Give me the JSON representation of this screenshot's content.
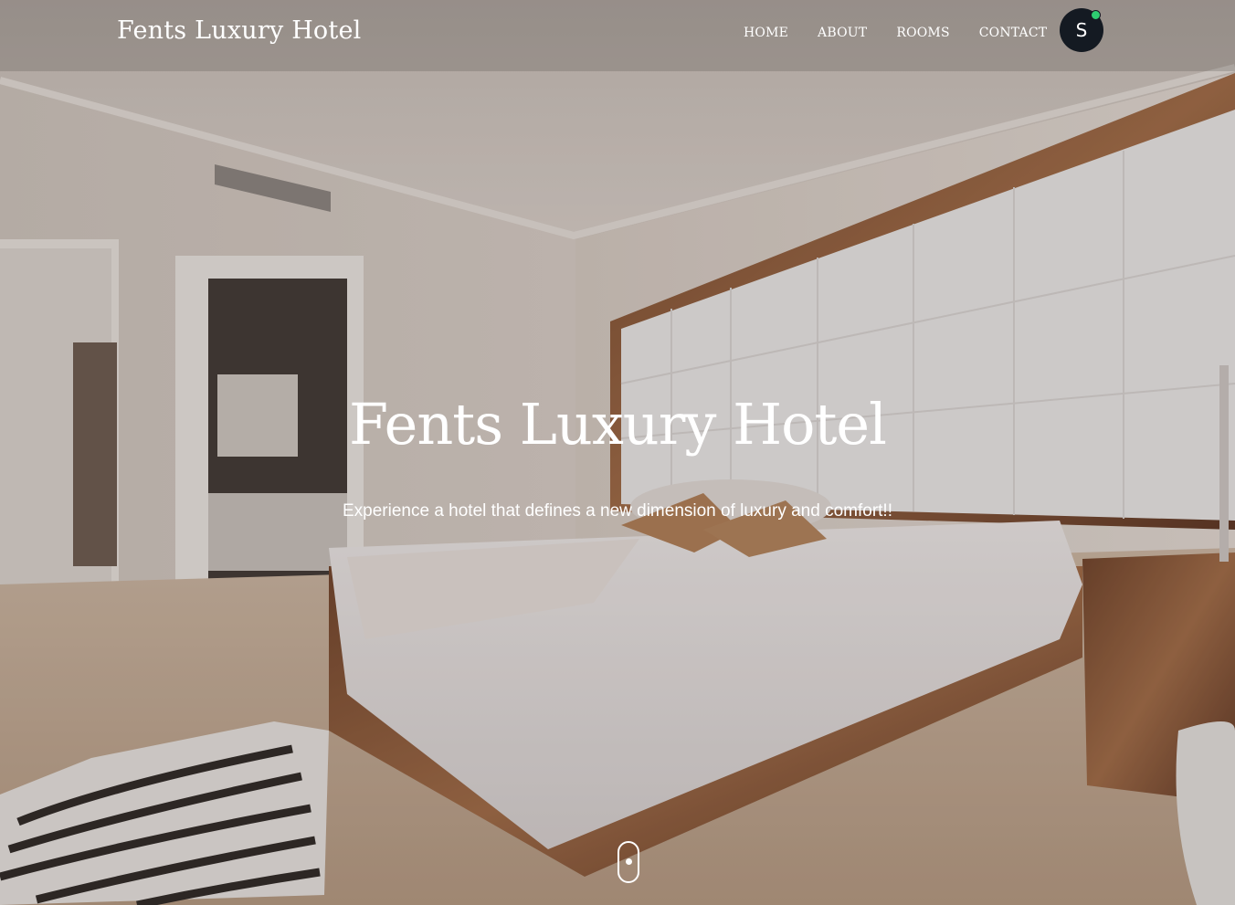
{
  "header": {
    "brand": "Fents Luxury Hotel",
    "nav": [
      {
        "label": "HOME"
      },
      {
        "label": "ABOUT"
      },
      {
        "label": "ROOMS"
      },
      {
        "label": "CONTACT"
      }
    ],
    "avatar_initial": "S"
  },
  "hero": {
    "title": "Fents Luxury Hotel",
    "subtitle": "Experience a hotel that defines a new dimension of luxury and comfort!!"
  },
  "colors": {
    "avatar_bg": "#141a22",
    "online_status": "#2ecc71",
    "text": "#ffffff"
  },
  "icons": {
    "scroll": "mouse-scroll-icon"
  }
}
